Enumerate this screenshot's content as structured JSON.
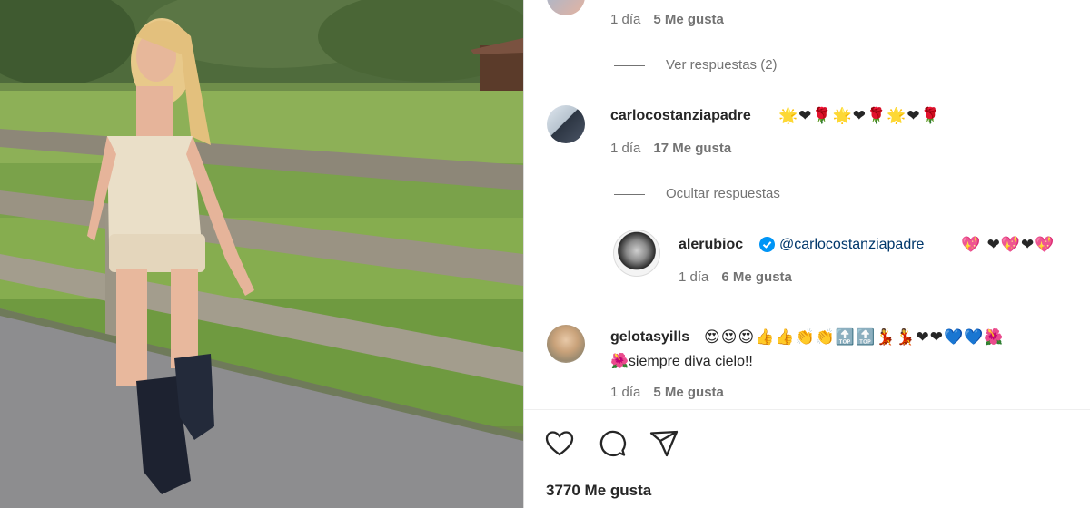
{
  "comments": [
    {
      "meta": {
        "time": "1 día",
        "likes": "5 Me gusta"
      },
      "thread": "Ver respuestas (2)"
    },
    {
      "username": "carlocostanziapadre",
      "emojis": "🌟❤🌹🌟❤🌹🌟❤🌹",
      "meta": {
        "time": "1 día",
        "likes": "17 Me gusta"
      },
      "thread": "Ocultar respuestas",
      "reply": {
        "username": "alerubioc",
        "verified": true,
        "mention": "@carlocostanziapadre",
        "emojis": "💖 ❤💖❤💖",
        "meta": {
          "time": "1 día",
          "likes": "6 Me gusta"
        }
      }
    },
    {
      "username": "gelotasyills",
      "emojis": "😍😍😍👍👍👏👏🔝🔝💃💃❤❤💙💙🌺",
      "text_emoji": "🌺",
      "text": "siempre diva cielo!!",
      "meta": {
        "time": "1 día",
        "likes": "5 Me gusta"
      }
    }
  ],
  "actions": {
    "like": "heart-icon",
    "comment": "comment-icon",
    "share": "share-icon"
  },
  "likes_total": "3770 Me gusta",
  "colors": {
    "mention": "#00376b",
    "meta": "#737373",
    "verified": "#0095f6"
  }
}
